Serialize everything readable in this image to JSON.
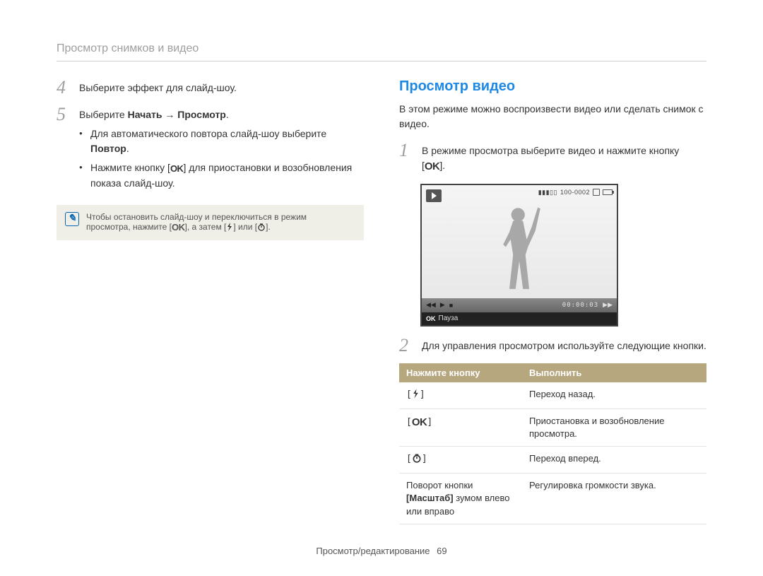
{
  "header": {
    "title": "Просмотр снимков и видео"
  },
  "left": {
    "step4": {
      "num": "4",
      "text": "Выберите эффект для слайд-шоу."
    },
    "step5": {
      "num": "5",
      "prefix": "Выберите ",
      "bold": "Начать → Просмотр",
      "suffix": ".",
      "bullets": [
        {
          "text_a": "Для автоматического повтора слайд-шоу выберите ",
          "bold": "Повтор",
          "text_b": "."
        },
        {
          "text_a": "Нажмите кнопку [",
          "ok": "OK",
          "text_b": "] для приостановки и возобновления показа слайд-шоу."
        }
      ]
    },
    "note": {
      "line1": "Чтобы остановить слайд-шоу и переключиться в режим",
      "line2_a": "просмотра, нажмите [",
      "ok": "OK",
      "line2_b": "], а затем [",
      "flash": "⚡",
      "line2_c": "] или [",
      "timer": "⏲",
      "line2_d": "]."
    }
  },
  "right": {
    "title": "Просмотр видео",
    "intro": "В этом режиме можно воспроизвести видео или сделать снимок с видео.",
    "step1": {
      "num": "1",
      "text_a": "В режиме просмотра выберите видео и нажмите кнопку",
      "text_b": "[",
      "ok": "OK",
      "text_c": "]."
    },
    "preview": {
      "top_right": "100-0002",
      "time": "00:00:03",
      "footer_ok": "OK",
      "footer_label": "Пауза"
    },
    "step2": {
      "num": "2",
      "text": "Для управления просмотром используйте следующие кнопки."
    },
    "table": {
      "head": {
        "c1": "Нажмите кнопку",
        "c2": "Выполнить"
      },
      "rows": [
        {
          "key_type": "flash",
          "label": "",
          "action": "Переход назад."
        },
        {
          "key_type": "ok",
          "label": "OK",
          "action": "Приостановка и возобновление просмотра."
        },
        {
          "key_type": "timer",
          "label": "",
          "action": "Переход вперед."
        },
        {
          "key_type": "text",
          "t1": "Поворот кнопки ",
          "bold": "[Масштаб]",
          "t2": " зумом влево или вправо",
          "action": "Регулировка громкости звука."
        }
      ]
    }
  },
  "footer": {
    "section": "Просмотр/редактирование",
    "page": "69"
  }
}
